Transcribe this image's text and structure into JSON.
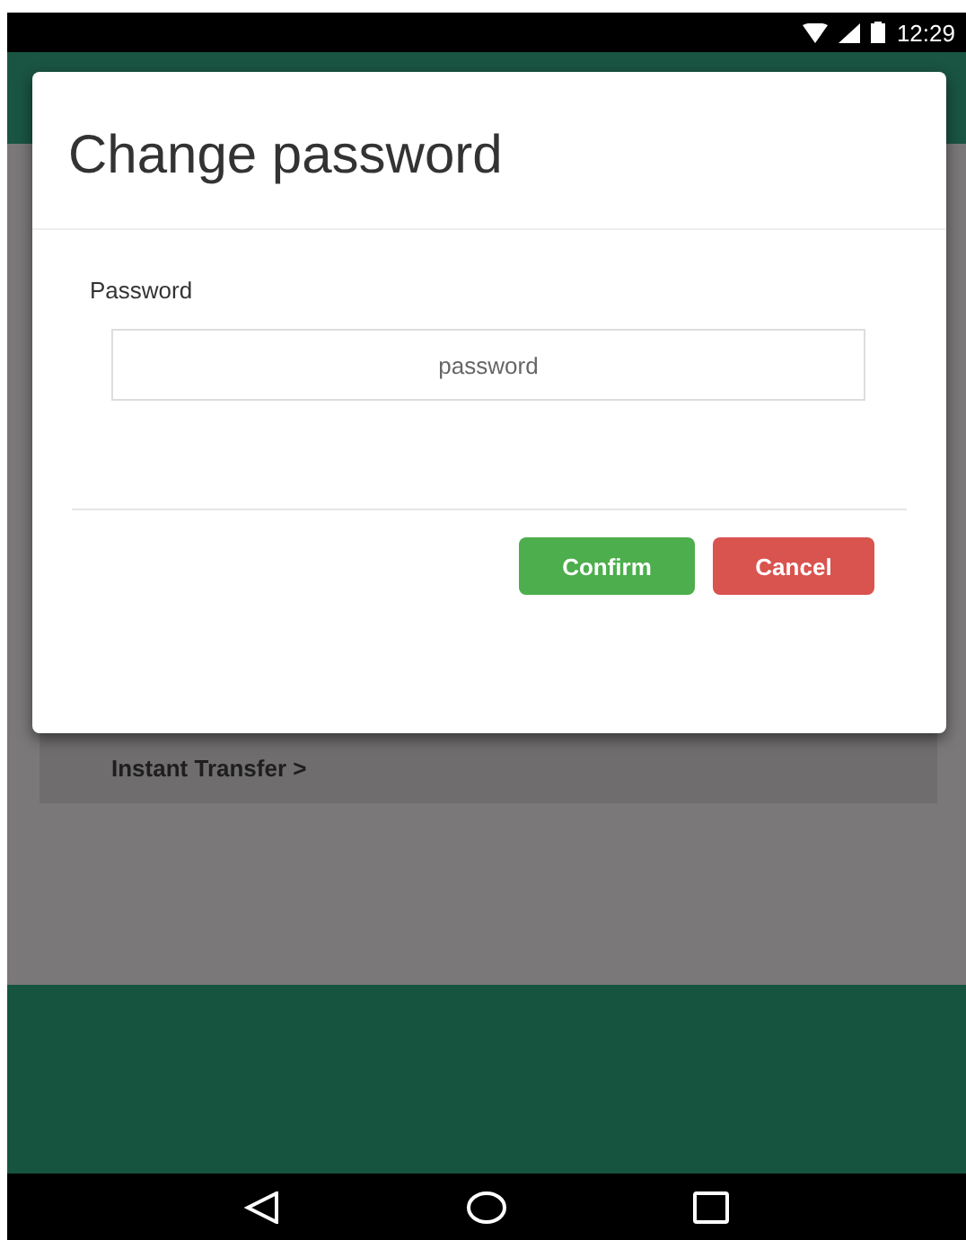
{
  "status_bar": {
    "time": "12:29"
  },
  "background": {
    "link": "Instant Transfer >"
  },
  "dialog": {
    "title": "Change password",
    "field": {
      "label": "Password",
      "placeholder": "password"
    },
    "buttons": [
      {
        "label": "Confirm",
        "kind": "primary"
      },
      {
        "label": "Cancel",
        "kind": "danger"
      }
    ]
  }
}
